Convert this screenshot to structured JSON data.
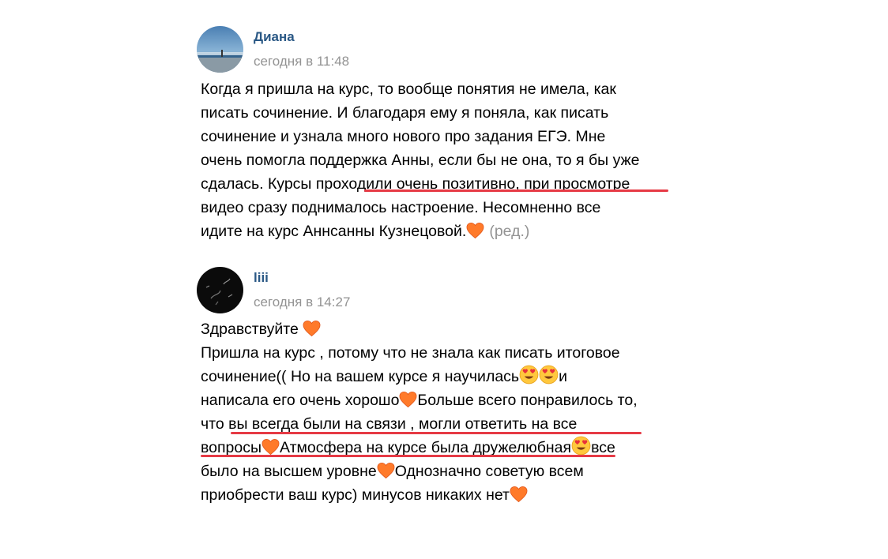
{
  "posts": [
    {
      "author": "Диана",
      "time": "сегодня в 11:48",
      "lines": [
        "Когда я пришла на курс, то вообще понятия не имела, как",
        "писать сочинение. И благодаря ему я поняла, как писать",
        "сочинение и узнала много нового про задания ЕГЭ. Мне",
        "очень помогла поддержка Анны, если бы не она, то я бы уже",
        "сдалась. Курсы проходили очень позитивно, при просмотре",
        "видео сразу поднималось настроение. Несомненно все",
        "идите на курс Аннсанны Кузнецовой."
      ],
      "edited": "(ред.)"
    },
    {
      "author": "liii",
      "time": "сегодня в 14:27",
      "lines": {
        "l1": "Здравствуйте ",
        "l2": "Пришла на курс , потому что не знала как писать итоговое",
        "l3a": "сочинение(( Но на вашем курсе я научилась",
        "l3b": "и",
        "l4a": "написала его очень хорошо",
        "l4b": "Больше всего понравилось то,",
        "l5": "что вы всегда были на связи , могли ответить на все",
        "l6a": "вопросы",
        "l6b": "Атмосфера на курсе была дружелюбная",
        "l6c": "все",
        "l7a": "было на высшем уровне",
        "l7b": "Однозначно советую всем",
        "l8a": "приобрести ваш курс) минусов никаких нет"
      }
    }
  ],
  "colors": {
    "author": "#2a5885",
    "time": "#939393",
    "underline": "#e63a45",
    "heart": "#ff7a2a"
  },
  "icons": {
    "heart": "orange-heart-emoji-icon",
    "love": "heart-eyes-emoji-icon"
  }
}
